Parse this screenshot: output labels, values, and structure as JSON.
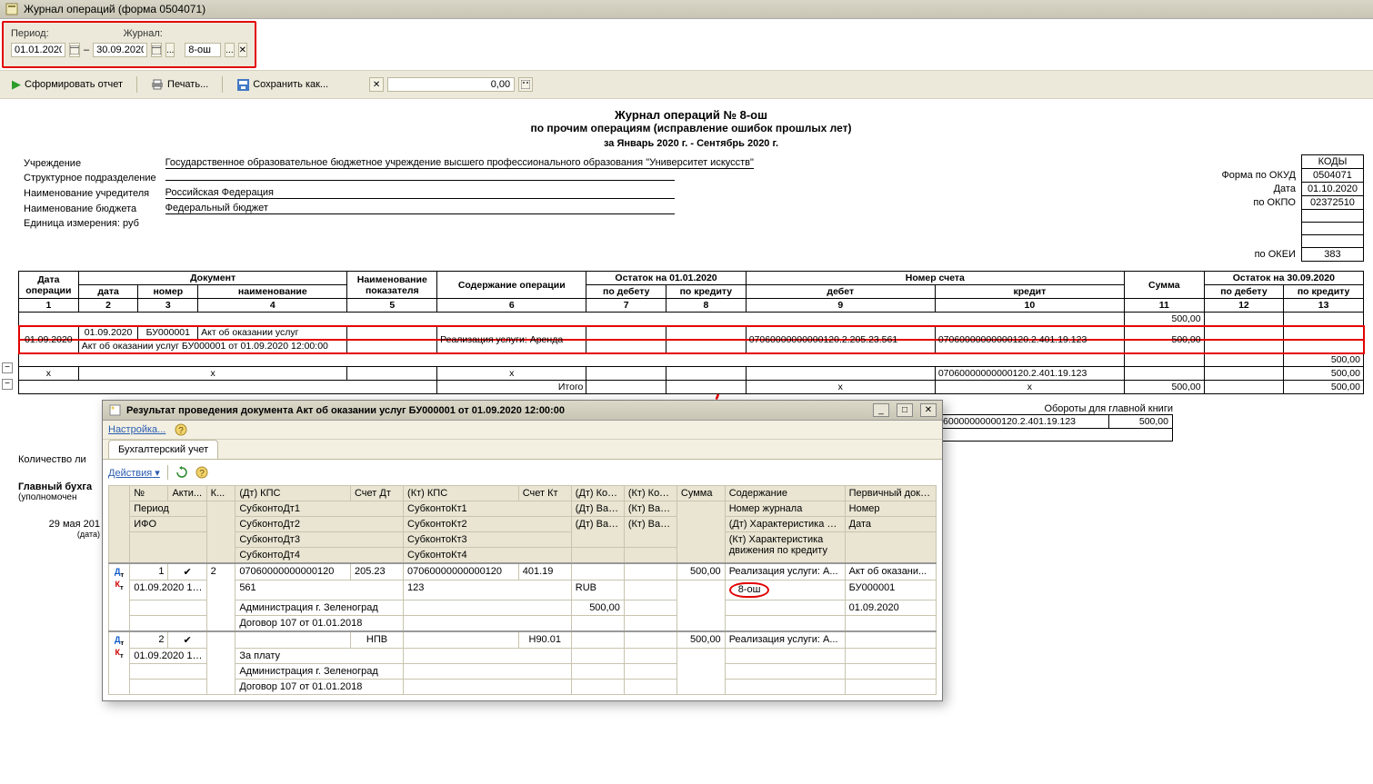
{
  "window": {
    "title": "Журнал операций (форма 0504071)"
  },
  "filter": {
    "period_label": "Период:",
    "date_from": "01.01.2020",
    "date_to": "30.09.2020",
    "journal_label": "Журнал:",
    "journal_value": "8-ош",
    "sep": "–"
  },
  "toolbar": {
    "generate": "Сформировать отчет",
    "print": "Печать...",
    "save_as": "Сохранить как...",
    "amount": "0,00"
  },
  "report": {
    "title": "Журнал операций № 8-ош",
    "subtitle": "по прочим операциям (исправление ошибок прошлых лет)",
    "period": "за Январь 2020 г. - Сентябрь 2020 г.",
    "inst_long": "Государственное образовательное бюджетное учреждение высшего профессионального образования \"Университет искусств\"",
    "labels": {
      "inst": "Учреждение",
      "subdiv": "Структурное подразделение",
      "founder": "Наименование учредителя",
      "budget": "Наименование бюджета",
      "unit": "Единица измерения: руб"
    },
    "founder_val": "Российская Федерация",
    "budget_val": "Федеральный бюджет",
    "codes": {
      "header": "КОДЫ",
      "okud_l": "Форма по ОКУД",
      "okud_v": "0504071",
      "date_l": "Дата",
      "date_v": "01.10.2020",
      "okpo_l": "по ОКПО",
      "okpo_v": "02372510",
      "okei_l": "по ОКЕИ",
      "okei_v": "383"
    },
    "headers": {
      "op_date": "Дата операции",
      "doc": "Документ",
      "doc_date": "дата",
      "doc_num": "номер",
      "doc_name": "наименование",
      "metric": "Наименование показателя",
      "content": "Содержание операции",
      "balance_start": "Остаток на 01.01.2020",
      "debit": "по дебету",
      "credit": "по кредиту",
      "account": "Номер счета",
      "acc_debit": "дебет",
      "acc_credit": "кредит",
      "sum": "Сумма",
      "balance_end": "Остаток на 30.09.2020"
    },
    "colnums": [
      "1",
      "2",
      "3",
      "4",
      "5",
      "6",
      "7",
      "8",
      "9",
      "10",
      "11",
      "12",
      "13"
    ],
    "row": {
      "op_date": "01.09.2020",
      "doc_date": "01.09.2020",
      "doc_num": "БУ000001",
      "doc_name": "Акт об оказании услуг",
      "doc_full": "Акт об оказании услуг БУ000001 от 01.09.2020 12:00:00",
      "content": "Реализация услуги: Аренда",
      "acc_debit": "07060000000000120.2.205.23.561",
      "acc_credit": "07060000000000120.2.401.19.123",
      "sum": "500,00"
    },
    "itogo": "Итого",
    "x": "x",
    "sum500": "500,00",
    "turnover_label": "Обороты для главной книги",
    "footer_lines": {
      "count": "Количество ли",
      "chief": "Главный бухга",
      "auth": "(уполномочен",
      "date": "29 мая 201",
      "date_sub": "(дата)"
    }
  },
  "popup": {
    "title": "Результат проведения документа Акт об оказании услуг БУ000001 от 01.09.2020 12:00:00",
    "settings": "Настройка...",
    "tab": "Бухгалтерский учет",
    "actions": "Действия",
    "headers": {
      "n": "№",
      "active": "Акти...",
      "k": "К...",
      "dt_kps": "(Дт) КПС",
      "acc_dt": "Счет Дт",
      "kt_kps": "(Кт) КПС",
      "acc_kt": "Счет Кт",
      "dt_qty": "(Дт) Кол...",
      "kt_qty": "(Кт) Кол...",
      "sum": "Сумма",
      "content": "Содержание",
      "primary": "Первичный доку...",
      "period": "Период",
      "sub_dt1": "СубконтоДт1",
      "sub_kt1": "СубконтоКт1",
      "dt_val": "(Дт) Вал...",
      "kt_val": "(Кт) Вал...",
      "journal": "Номер журнала",
      "number": "Номер",
      "ifo": "ИФО",
      "sub_dt2": "СубконтоДт2",
      "sub_kt2": "СубконтоКт2",
      "dt_val_sum": "(Дт) Вал. сумма",
      "kt_val_sum": "(Кт) Вал. сумма",
      "dt_char": "(Дт) Характеристика д...",
      "date": "Дата",
      "sub_dt3": "СубконтоДт3",
      "sub_kt3": "СубконтоКт3",
      "kt_char": "(Кт) Характеристика движения по кредиту",
      "sub_dt4": "СубконтоДт4",
      "sub_kt4": "СубконтоКт4"
    },
    "row1": {
      "n": "1",
      "check": "✔",
      "k": "2",
      "dt_kps": "07060000000000120",
      "acc_dt": "205.23",
      "kt_kps": "07060000000000120",
      "acc_kt": "401.19",
      "sum": "500,00",
      "content": "Реализация услуги: А...",
      "primary": "Акт об оказани...",
      "period": "01.09.2020 12...",
      "sub_dt1": "561",
      "sub_kt1": "123",
      "dt_val": "RUB",
      "journal": "8-ош",
      "number": "БУ000001",
      "sub_dt2": "Администрация г. Зеленоград",
      "dt_val_sum": "500,00",
      "date": "01.09.2020",
      "sub_dt3": "Договор 107 от 01.01.2018"
    },
    "row2": {
      "n": "2",
      "check": "✔",
      "acc_dt": "НПВ",
      "acc_kt": "Н90.01",
      "sum": "500,00",
      "content": "Реализация услуги: А...",
      "period": "01.09.2020 12...",
      "sub_dt1": "За плату",
      "sub_dt2": "Администрация г. Зеленоград",
      "sub_dt3": "Договор 107 от 01.01.2018"
    }
  }
}
